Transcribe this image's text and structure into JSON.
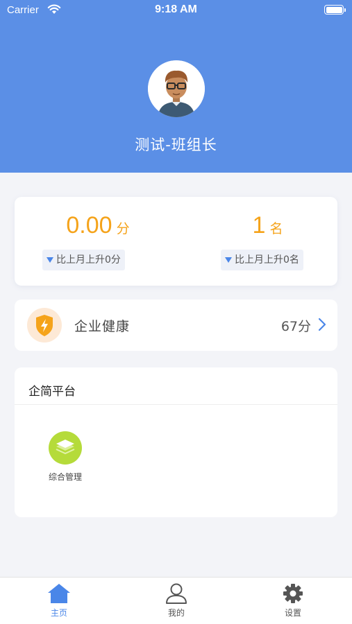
{
  "status_bar": {
    "carrier": "Carrier",
    "time": "9:18 AM"
  },
  "profile": {
    "name": "测试-班组长"
  },
  "stats": {
    "score_value": "0.00",
    "score_unit": "分",
    "score_change": "比上月上升0分",
    "rank_value": "1",
    "rank_unit": "名",
    "rank_change": "比上月上升0名"
  },
  "health": {
    "label": "企业健康",
    "score": "67分"
  },
  "platform": {
    "title": "企简平台",
    "apps": [
      {
        "label": "综合管理",
        "icon": "layers-icon"
      }
    ]
  },
  "tabbar": {
    "items": [
      {
        "label": "主页",
        "icon": "home-icon",
        "active": true
      },
      {
        "label": "我的",
        "icon": "user-icon",
        "active": false
      },
      {
        "label": "设置",
        "icon": "gear-icon",
        "active": false
      }
    ]
  },
  "colors": {
    "header_bg": "#5b8fe6",
    "accent_orange": "#f5a31a",
    "accent_blue": "#4a86e8",
    "app_icon_green": "#b5db3a"
  }
}
